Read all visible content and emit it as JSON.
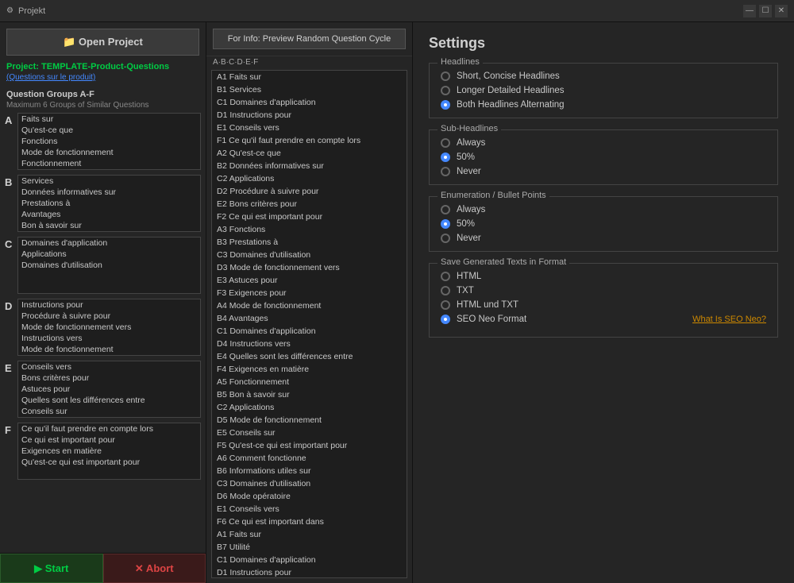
{
  "titleBar": {
    "icon": "📁",
    "title": "Projekt",
    "minLabel": "—",
    "maxLabel": "☐",
    "closeLabel": "✕"
  },
  "leftPanel": {
    "openProjectLabel": "📁 Open Project",
    "projectName": "Project: TEMPLATE-Product-Questions",
    "projectSubtitle": "(Questions sur le produit)",
    "sectionTitle": "Question Groups A-F",
    "sectionSubtitle": "Maximum 6 Groups of Similar Questions",
    "groups": [
      {
        "label": "A",
        "items": [
          "Faits sur",
          "Qu'est-ce que",
          "Fonctions",
          "Mode de fonctionnement",
          "Fonctionnement"
        ]
      },
      {
        "label": "B",
        "items": [
          "Services",
          "Données informatives sur",
          "Prestations à",
          "Avantages",
          "Bon à savoir sur"
        ]
      },
      {
        "label": "C",
        "items": [
          "Domaines d'application",
          "Applications",
          "Domaines d'utilisation"
        ]
      },
      {
        "label": "D",
        "items": [
          "Instructions pour",
          "Procédure à suivre pour",
          "Mode de fonctionnement vers",
          "Instructions vers",
          "Mode de fonctionnement"
        ]
      },
      {
        "label": "E",
        "items": [
          "Conseils vers",
          "Bons critères pour",
          "Astuces pour",
          "Quelles sont les différences entre",
          "Conseils sur"
        ]
      },
      {
        "label": "F",
        "items": [
          "Ce qu'il faut prendre en compte lors",
          "Ce qui est important pour",
          "Exigences en matière",
          "Qu'est-ce qui est important pour"
        ]
      }
    ],
    "startLabel": "▶ Start",
    "abortLabel": "✕ Abort"
  },
  "middlePanel": {
    "previewBtnLabel": "For Info: Preview Random Question Cycle",
    "abcLabel": "A·B·C·D·E·F",
    "questions": [
      "A1 Faits sur",
      "B1 Services",
      "C1 Domaines d'application",
      "D1 Instructions pour",
      "E1 Conseils vers",
      "F1 Ce qu'il faut prendre en compte lors",
      "A2 Qu'est-ce que",
      "B2 Données informatives sur",
      "C2 Applications",
      "D2 Procédure à suivre pour",
      "E2 Bons critères pour",
      "F2 Ce qui est important pour",
      "A3 Fonctions",
      "B3 Prestations à",
      "C3 Domaines d'utilisation",
      "D3 Mode de fonctionnement vers",
      "E3 Astuces pour",
      "F3 Exigences pour",
      "A4 Mode de fonctionnement",
      "B4 Avantages",
      "C1 Domaines d'application",
      "D4 Instructions vers",
      "E4 Quelles sont les différences entre",
      "F4 Exigences en matière",
      "A5 Fonctionnement",
      "B5 Bon à savoir sur",
      "C2 Applications",
      "D5 Mode de fonctionnement",
      "E5 Conseils sur",
      "F5 Qu'est-ce qui est important pour",
      "A6 Comment fonctionne",
      "B6 Informations utiles sur",
      "C3 Domaines d'utilisation",
      "D6 Mode opératoire",
      "E1 Conseils vers",
      "F6 Ce qui est important dans",
      "A1 Faits sur",
      "B7 Utilité",
      "C1 Domaines d'application",
      "D1 Instructions pour"
    ]
  },
  "rightPanel": {
    "title": "Settings",
    "headlines": {
      "groupTitle": "Headlines",
      "options": [
        {
          "label": "Short, Concise Headlines",
          "selected": false
        },
        {
          "label": "Longer Detailed Headlines",
          "selected": false
        },
        {
          "label": "Both Headlines Alternating",
          "selected": true
        }
      ]
    },
    "subHeadlines": {
      "groupTitle": "Sub-Headlines",
      "options": [
        {
          "label": "Always",
          "selected": false
        },
        {
          "label": "50%",
          "selected": true
        },
        {
          "label": "Never",
          "selected": false
        }
      ]
    },
    "enumeration": {
      "groupTitle": "Enumeration / Bullet Points",
      "options": [
        {
          "label": "Always",
          "selected": false
        },
        {
          "label": "50%",
          "selected": true
        },
        {
          "label": "Never",
          "selected": false
        }
      ]
    },
    "saveFormat": {
      "groupTitle": "Save Generated Texts in Format",
      "options": [
        {
          "label": "HTML",
          "selected": false
        },
        {
          "label": "TXT",
          "selected": false
        },
        {
          "label": "HTML und TXT",
          "selected": false
        },
        {
          "label": "SEO Neo Format",
          "selected": true
        }
      ],
      "whatIsLink": "What Is SEO Neo?"
    }
  }
}
